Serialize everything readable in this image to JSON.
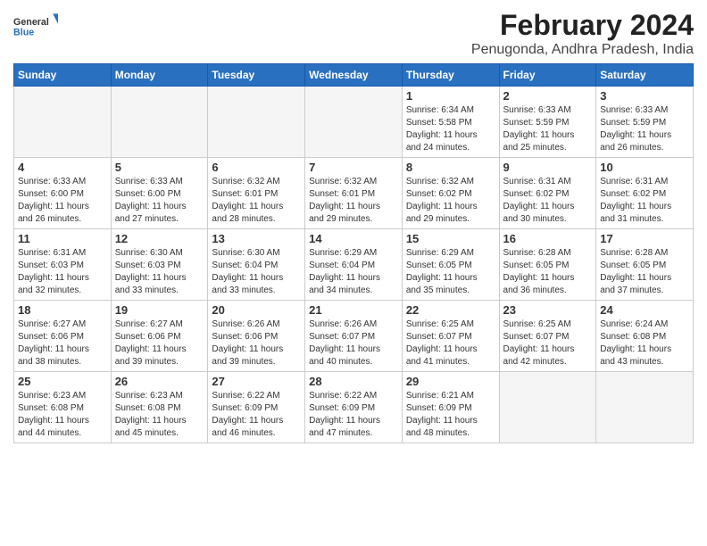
{
  "header": {
    "logo_general": "General",
    "logo_blue": "Blue",
    "title": "February 2024",
    "subtitle": "Penugonda, Andhra Pradesh, India"
  },
  "days_of_week": [
    "Sunday",
    "Monday",
    "Tuesday",
    "Wednesday",
    "Thursday",
    "Friday",
    "Saturday"
  ],
  "weeks": [
    [
      {
        "day": "",
        "info": ""
      },
      {
        "day": "",
        "info": ""
      },
      {
        "day": "",
        "info": ""
      },
      {
        "day": "",
        "info": ""
      },
      {
        "day": "1",
        "info": "Sunrise: 6:34 AM\nSunset: 5:58 PM\nDaylight: 11 hours\nand 24 minutes."
      },
      {
        "day": "2",
        "info": "Sunrise: 6:33 AM\nSunset: 5:59 PM\nDaylight: 11 hours\nand 25 minutes."
      },
      {
        "day": "3",
        "info": "Sunrise: 6:33 AM\nSunset: 5:59 PM\nDaylight: 11 hours\nand 26 minutes."
      }
    ],
    [
      {
        "day": "4",
        "info": "Sunrise: 6:33 AM\nSunset: 6:00 PM\nDaylight: 11 hours\nand 26 minutes."
      },
      {
        "day": "5",
        "info": "Sunrise: 6:33 AM\nSunset: 6:00 PM\nDaylight: 11 hours\nand 27 minutes."
      },
      {
        "day": "6",
        "info": "Sunrise: 6:32 AM\nSunset: 6:01 PM\nDaylight: 11 hours\nand 28 minutes."
      },
      {
        "day": "7",
        "info": "Sunrise: 6:32 AM\nSunset: 6:01 PM\nDaylight: 11 hours\nand 29 minutes."
      },
      {
        "day": "8",
        "info": "Sunrise: 6:32 AM\nSunset: 6:02 PM\nDaylight: 11 hours\nand 29 minutes."
      },
      {
        "day": "9",
        "info": "Sunrise: 6:31 AM\nSunset: 6:02 PM\nDaylight: 11 hours\nand 30 minutes."
      },
      {
        "day": "10",
        "info": "Sunrise: 6:31 AM\nSunset: 6:02 PM\nDaylight: 11 hours\nand 31 minutes."
      }
    ],
    [
      {
        "day": "11",
        "info": "Sunrise: 6:31 AM\nSunset: 6:03 PM\nDaylight: 11 hours\nand 32 minutes."
      },
      {
        "day": "12",
        "info": "Sunrise: 6:30 AM\nSunset: 6:03 PM\nDaylight: 11 hours\nand 33 minutes."
      },
      {
        "day": "13",
        "info": "Sunrise: 6:30 AM\nSunset: 6:04 PM\nDaylight: 11 hours\nand 33 minutes."
      },
      {
        "day": "14",
        "info": "Sunrise: 6:29 AM\nSunset: 6:04 PM\nDaylight: 11 hours\nand 34 minutes."
      },
      {
        "day": "15",
        "info": "Sunrise: 6:29 AM\nSunset: 6:05 PM\nDaylight: 11 hours\nand 35 minutes."
      },
      {
        "day": "16",
        "info": "Sunrise: 6:28 AM\nSunset: 6:05 PM\nDaylight: 11 hours\nand 36 minutes."
      },
      {
        "day": "17",
        "info": "Sunrise: 6:28 AM\nSunset: 6:05 PM\nDaylight: 11 hours\nand 37 minutes."
      }
    ],
    [
      {
        "day": "18",
        "info": "Sunrise: 6:27 AM\nSunset: 6:06 PM\nDaylight: 11 hours\nand 38 minutes."
      },
      {
        "day": "19",
        "info": "Sunrise: 6:27 AM\nSunset: 6:06 PM\nDaylight: 11 hours\nand 39 minutes."
      },
      {
        "day": "20",
        "info": "Sunrise: 6:26 AM\nSunset: 6:06 PM\nDaylight: 11 hours\nand 39 minutes."
      },
      {
        "day": "21",
        "info": "Sunrise: 6:26 AM\nSunset: 6:07 PM\nDaylight: 11 hours\nand 40 minutes."
      },
      {
        "day": "22",
        "info": "Sunrise: 6:25 AM\nSunset: 6:07 PM\nDaylight: 11 hours\nand 41 minutes."
      },
      {
        "day": "23",
        "info": "Sunrise: 6:25 AM\nSunset: 6:07 PM\nDaylight: 11 hours\nand 42 minutes."
      },
      {
        "day": "24",
        "info": "Sunrise: 6:24 AM\nSunset: 6:08 PM\nDaylight: 11 hours\nand 43 minutes."
      }
    ],
    [
      {
        "day": "25",
        "info": "Sunrise: 6:23 AM\nSunset: 6:08 PM\nDaylight: 11 hours\nand 44 minutes."
      },
      {
        "day": "26",
        "info": "Sunrise: 6:23 AM\nSunset: 6:08 PM\nDaylight: 11 hours\nand 45 minutes."
      },
      {
        "day": "27",
        "info": "Sunrise: 6:22 AM\nSunset: 6:09 PM\nDaylight: 11 hours\nand 46 minutes."
      },
      {
        "day": "28",
        "info": "Sunrise: 6:22 AM\nSunset: 6:09 PM\nDaylight: 11 hours\nand 47 minutes."
      },
      {
        "day": "29",
        "info": "Sunrise: 6:21 AM\nSunset: 6:09 PM\nDaylight: 11 hours\nand 48 minutes."
      },
      {
        "day": "",
        "info": ""
      },
      {
        "day": "",
        "info": ""
      }
    ]
  ]
}
